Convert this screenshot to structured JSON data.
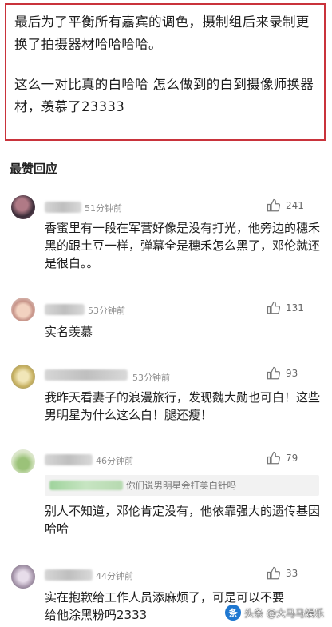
{
  "post": {
    "paragraph1": "最后为了平衡所有嘉宾的调色，摄制组后来录制更换了拍摄器材哈哈哈哈。",
    "paragraph2": "这么一对比真的白哈哈 怎么做到的白到摄像师换器材，羡慕了23333"
  },
  "section_title": "最赞回应",
  "comments": [
    {
      "time": "51分钟前",
      "likes": "241",
      "text": "香蜜里有一段在军营好像是没有打光，他旁边的穗禾黑的跟土豆一样，弹幕全是穗禾怎么黑了，邓伦就还是很白。。"
    },
    {
      "time": "53分钟前",
      "likes": "131",
      "text": "实名羡慕"
    },
    {
      "time": "53分钟前",
      "likes": "93",
      "text": "我昨天看妻子的浪漫旅行，发现魏大勋也可白！这些男明星为什么这么白！腿还瘦！"
    },
    {
      "time": "46分钟前",
      "likes": "79",
      "quote": "你们说男明星会打美白针吗",
      "text": "别人不知道，邓伦肯定没有，他依靠强大的遗传基因哈哈"
    },
    {
      "time": "44分钟前",
      "likes": "33",
      "text": "实在抱歉给工作人员添麻烦了，可是可以不要给他涂黑粉吗2333"
    }
  ],
  "watermark": {
    "label": "头条 @大马马娱乐",
    "logo": "条"
  },
  "icons": [
    "thumbs-up-icon",
    "avatar"
  ],
  "colors": {
    "border": "#c9333b",
    "time": "#8d8d8d"
  }
}
